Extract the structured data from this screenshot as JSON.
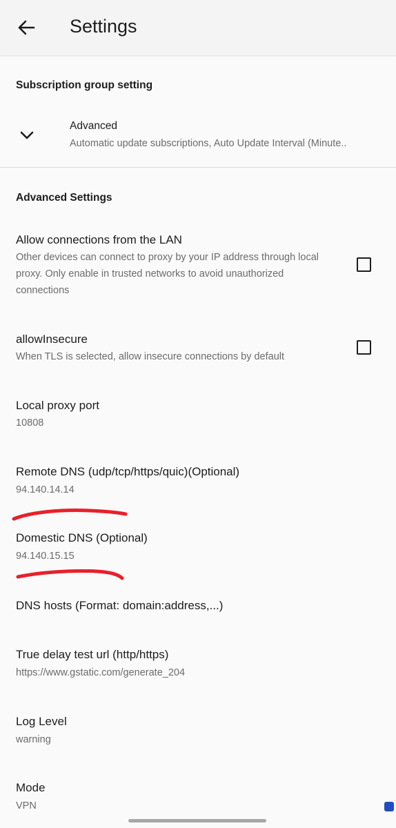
{
  "app_bar": {
    "title": "Settings",
    "back_icon": "arrow-left-icon"
  },
  "subscription_section": {
    "header": "Subscription group setting",
    "expand_icon": "chevron-down-icon",
    "title": "Advanced",
    "summary": "Automatic update subscriptions, Auto Update Interval (Minute.."
  },
  "advanced_section": {
    "header": "Advanced Settings",
    "allow_lan": {
      "title": "Allow connections from the LAN",
      "summary": "Other devices can connect to proxy by your IP address through local proxy. Only enable in trusted networks to avoid unauthorized connections",
      "checked": false
    },
    "allow_insecure": {
      "title": "allowInsecure",
      "summary": "When TLS is selected, allow insecure connections by default",
      "checked": false
    },
    "local_proxy_port": {
      "title": "Local proxy port",
      "value": "10808"
    },
    "remote_dns": {
      "title": "Remote DNS (udp/tcp/https/quic)(Optional)",
      "value": "94.140.14.14"
    },
    "domestic_dns": {
      "title": "Domestic DNS (Optional)",
      "value": "94.140.15.15"
    },
    "dns_hosts": {
      "title": "DNS hosts (Format: domain:address,...)"
    },
    "delay_test_url": {
      "title": "True delay test url (http/https)",
      "value": "https://www.gstatic.com/generate_204"
    },
    "log_level": {
      "title": "Log Level",
      "value": "warning"
    },
    "mode": {
      "title": "Mode",
      "value": "VPN"
    }
  },
  "colors": {
    "annotation": "#e8202a",
    "text_primary": "#1c1c1c",
    "text_secondary": "#6b6b6b",
    "background": "#fafafa"
  }
}
